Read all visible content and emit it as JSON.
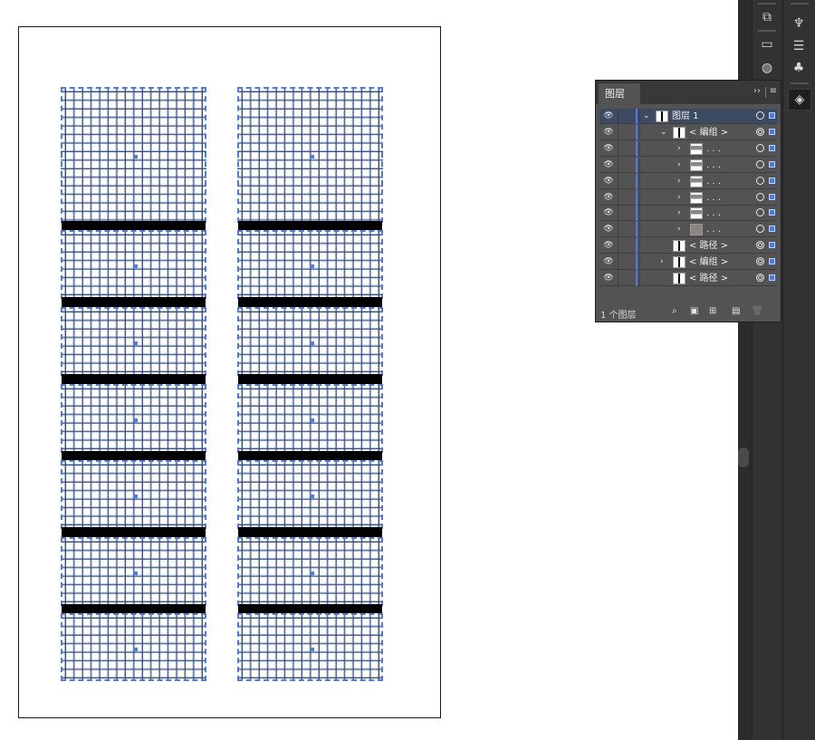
{
  "artboard": {
    "columns": 2,
    "blocks_per_column": 7
  },
  "layers_panel": {
    "tab_label": "图层",
    "collapse_glyph": "››",
    "menu_glyph": "≡",
    "rows": [
      {
        "name": "图层 1",
        "level": 0,
        "expand": "open",
        "selected": true,
        "thumb": "artboard"
      },
      {
        "name": "< 编组 >",
        "level": 1,
        "expand": "open",
        "thumb": "bars"
      },
      {
        "name": ". . .",
        "level": 2,
        "expand": "closed",
        "thumb": "gray"
      },
      {
        "name": ". . .",
        "level": 2,
        "expand": "closed",
        "thumb": "gray"
      },
      {
        "name": ". . .",
        "level": 2,
        "expand": "closed",
        "thumb": "gray"
      },
      {
        "name": ". . .",
        "level": 2,
        "expand": "closed",
        "thumb": "gray"
      },
      {
        "name": ". . .",
        "level": 2,
        "expand": "closed",
        "thumb": "gray"
      },
      {
        "name": ". . .",
        "level": 2,
        "expand": "closed",
        "thumb": "dark"
      },
      {
        "name": "< 路径 >",
        "level": 1,
        "expand": "none",
        "thumb": "bars"
      },
      {
        "name": "< 编组 >",
        "level": 1,
        "expand": "closed",
        "thumb": "bars"
      },
      {
        "name": "< 路径 >",
        "level": 1,
        "expand": "none",
        "thumb": "bars"
      }
    ],
    "footer": {
      "layer_count": "1 个图层",
      "icons": [
        "search-icon",
        "collect-icon",
        "sublayer-icon",
        "new-layer-icon",
        "delete-icon"
      ]
    }
  },
  "colors": {
    "selection_blue": "#4b7be5",
    "panel_bg": "#535353",
    "dock_bg": "#323232"
  }
}
